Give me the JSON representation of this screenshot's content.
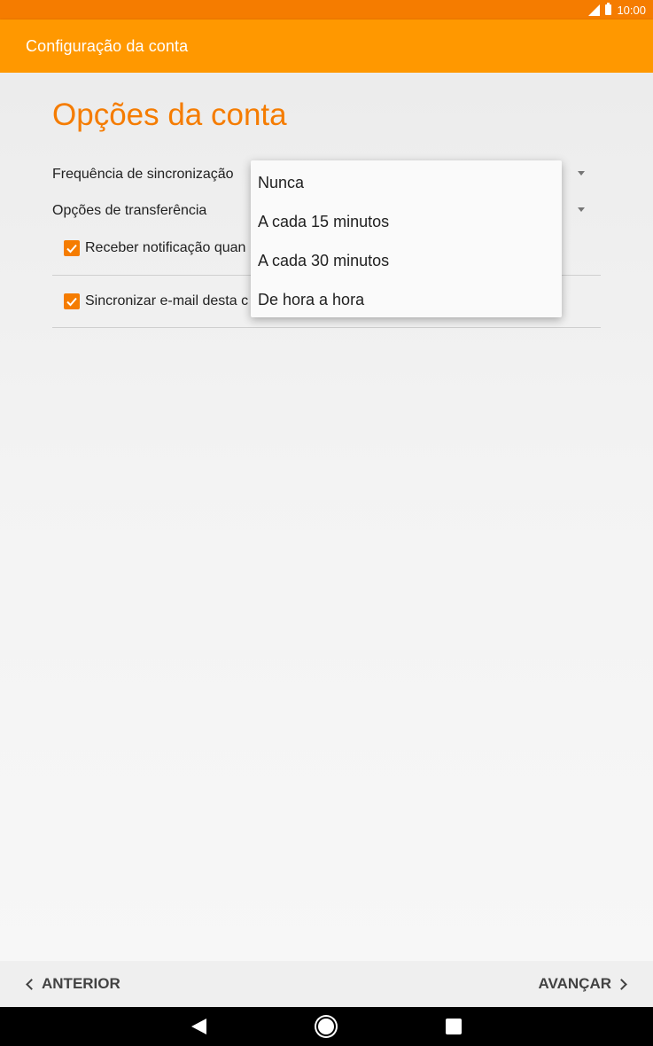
{
  "status_bar": {
    "time": "10:00"
  },
  "app_bar": {
    "title": "Configuração da conta"
  },
  "page": {
    "title": "Opções da conta",
    "fields": [
      {
        "label": "Frequência de sincronização"
      },
      {
        "label": "Opções de transferência"
      }
    ],
    "checkboxes": [
      {
        "label": "Receber notificação quan",
        "checked": true
      },
      {
        "label": "Sincronizar e-mail desta c",
        "checked": true
      }
    ]
  },
  "dropdown_menu": {
    "options": [
      "Nunca",
      "A cada 15 minutos",
      "A cada 30 minutos",
      "De hora a hora"
    ]
  },
  "bottom_bar": {
    "back_label": "ANTERIOR",
    "next_label": "AVANÇAR"
  },
  "colors": {
    "accent": "#ff9800",
    "status_bar": "#f57c00",
    "title": "#f57c00"
  }
}
